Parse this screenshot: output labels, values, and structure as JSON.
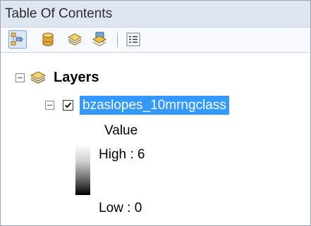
{
  "window": {
    "title": "Table Of Contents"
  },
  "toolbar": {
    "buttons": [
      {
        "name": "list-by-drawing-order",
        "icon": "list-by-drawing-order-icon",
        "active": true
      },
      {
        "name": "list-by-source",
        "icon": "list-by-source-icon",
        "active": false
      },
      {
        "name": "list-by-visibility",
        "icon": "list-by-visibility-icon",
        "active": false
      },
      {
        "name": "list-by-selection",
        "icon": "list-by-selection-icon",
        "active": false
      },
      {
        "name": "options",
        "icon": "options-icon",
        "active": false
      }
    ]
  },
  "tree": {
    "root_label": "Layers",
    "layer": {
      "name": "bzaslopes_10mrngclass",
      "checked": true,
      "legend": {
        "field_label": "Value",
        "high_label": "High : 6",
        "low_label": "Low : 0"
      }
    }
  },
  "colors": {
    "selection": "#3399ff",
    "titlebar": "#dde6f1"
  }
}
